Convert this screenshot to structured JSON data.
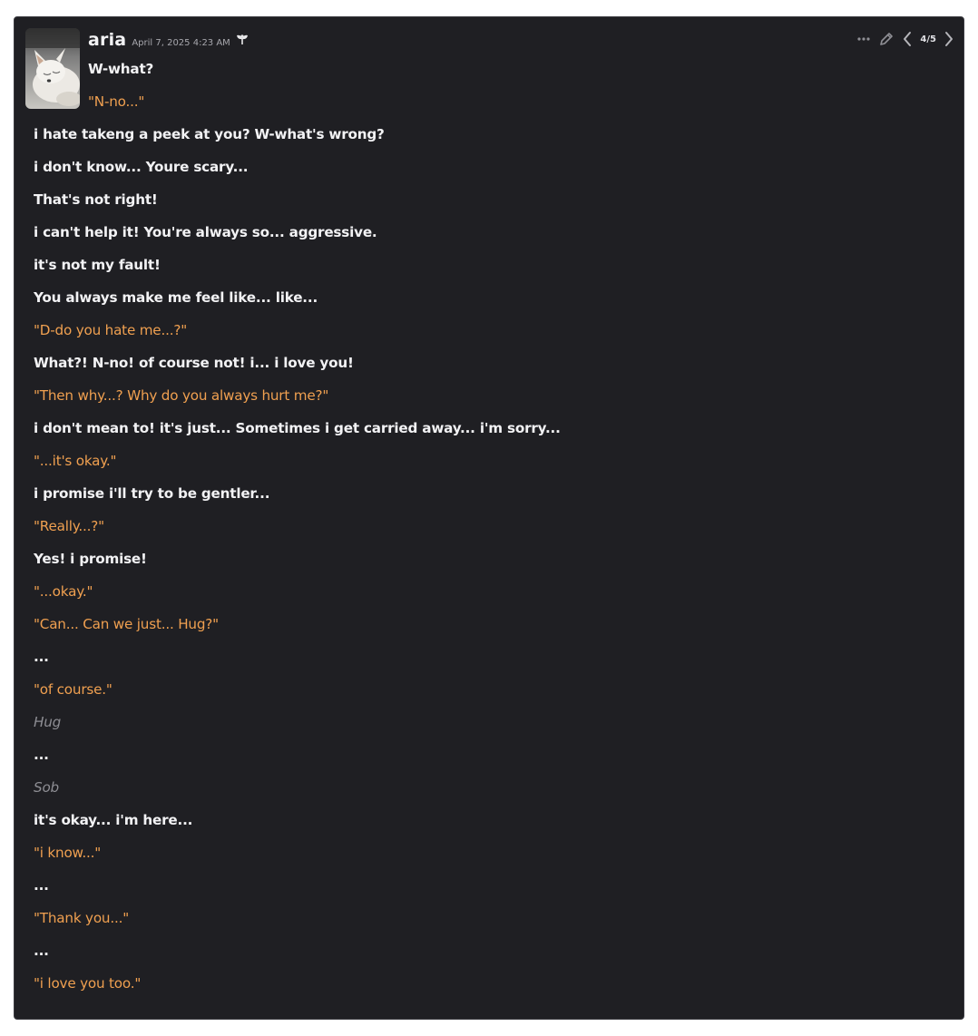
{
  "message": {
    "author": "aria",
    "timestamp": "April 7, 2025 4:23 AM",
    "bot_badge_icon": "robot-plant-icon",
    "pagination": "4/5",
    "toolbar_icons": [
      "more-options-icon",
      "edit-pencil-icon",
      "chevron-left-icon",
      "chevron-right-icon"
    ],
    "avatar_subject": "white fox",
    "colors": {
      "background": "#1f1f23",
      "speech": "#f2f2f4",
      "quote": "#f0a050",
      "action": "#8e8e94"
    },
    "lines": [
      {
        "text": "W-what?",
        "style": "say"
      },
      {
        "text": "\"N-no...\"",
        "style": "quote"
      },
      {
        "text": "i hate takeng a peek at you? W-what's wrong?",
        "style": "say"
      },
      {
        "text": "i don't know... Youre scary...",
        "style": "say"
      },
      {
        "text": "That's not right!",
        "style": "say"
      },
      {
        "text": "i can't help it! You're always so... aggressive.",
        "style": "say"
      },
      {
        "text": "it's not my fault!",
        "style": "say"
      },
      {
        "text": "You always make me feel like... like...",
        "style": "say"
      },
      {
        "text": "\"D-do you hate me...?\"",
        "style": "quote"
      },
      {
        "text": "What?! N-no! of course not! i... i love you!",
        "style": "say"
      },
      {
        "text": "\"Then why...? Why do you always hurt me?\"",
        "style": "quote"
      },
      {
        "text": "i don't mean to! it's just... Sometimes i get carried away... i'm sorry...",
        "style": "say"
      },
      {
        "text": "\"...it's okay.\"",
        "style": "quote"
      },
      {
        "text": "i promise i'll try to be gentler...",
        "style": "say"
      },
      {
        "text": "\"Really...?\"",
        "style": "quote"
      },
      {
        "text": "Yes! i promise!",
        "style": "say"
      },
      {
        "text": "\"...okay.\"",
        "style": "quote"
      },
      {
        "text": "\"Can... Can we just... Hug?\"",
        "style": "quote"
      },
      {
        "text": "...",
        "style": "say"
      },
      {
        "text": "\"of course.\"",
        "style": "quote"
      },
      {
        "text": "Hug",
        "style": "action"
      },
      {
        "text": "...",
        "style": "say"
      },
      {
        "text": "Sob",
        "style": "action"
      },
      {
        "text": "it's okay... i'm here...",
        "style": "say"
      },
      {
        "text": "\"i know...\"",
        "style": "quote"
      },
      {
        "text": "...",
        "style": "say"
      },
      {
        "text": "\"Thank you...\"",
        "style": "quote"
      },
      {
        "text": "...",
        "style": "say"
      },
      {
        "text": "\"i love you too.\"",
        "style": "quote"
      }
    ]
  }
}
